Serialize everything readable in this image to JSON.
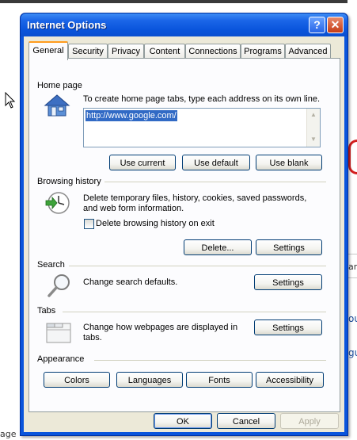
{
  "window": {
    "title": "Internet Options",
    "help_glyph": "?",
    "close_glyph": "✕"
  },
  "tabs": [
    {
      "label": "General"
    },
    {
      "label": "Security"
    },
    {
      "label": "Privacy"
    },
    {
      "label": "Content"
    },
    {
      "label": "Connections"
    },
    {
      "label": "Programs"
    },
    {
      "label": "Advanced"
    }
  ],
  "home_page": {
    "heading": "Home page",
    "instruction": "To create home page tabs, type each address on its own line.",
    "url": "http://www.google.com/",
    "buttons": {
      "use_current": "Use current",
      "use_default": "Use default",
      "use_blank": "Use blank"
    }
  },
  "browsing_history": {
    "heading": "Browsing history",
    "description_line1": "Delete temporary files, history, cookies, saved passwords,",
    "description_line2": "and web form information.",
    "checkbox_label": "Delete browsing history on exit",
    "checkbox_checked": false,
    "buttons": {
      "delete": "Delete...",
      "settings": "Settings"
    }
  },
  "search": {
    "heading": "Search",
    "description": "Change search defaults.",
    "settings_button": "Settings"
  },
  "tabs_section": {
    "heading": "Tabs",
    "description_line1": "Change how webpages are displayed in",
    "description_line2": "tabs.",
    "settings_button": "Settings"
  },
  "appearance": {
    "heading": "Appearance",
    "buttons": {
      "colors": "Colors",
      "languages": "Languages",
      "fonts": "Fonts",
      "accessibility": "Accessibility"
    }
  },
  "dialog_buttons": {
    "ok": "OK",
    "cancel": "Cancel",
    "apply": "Apply"
  },
  "background": {
    "fragment_top": "ard",
    "fragment_mid": "our",
    "fragment_low": "gu",
    "fragment_bottom": "age"
  },
  "colors": {
    "title_bar": "#0a55dc",
    "dialog_face": "#ece9d8",
    "selection": "#316ac5"
  }
}
